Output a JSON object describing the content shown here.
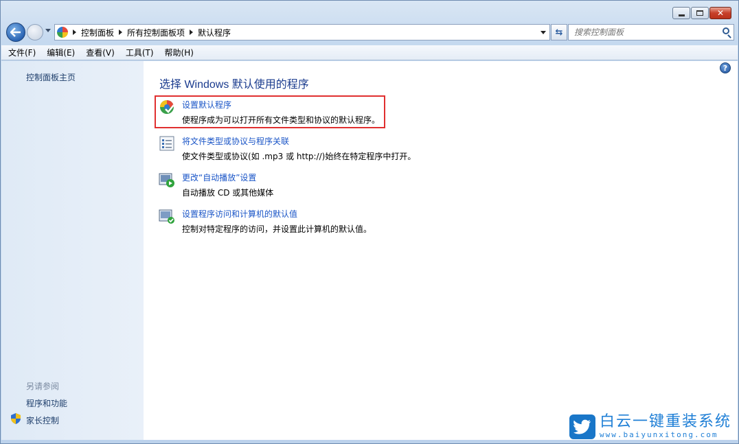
{
  "window": {
    "caption_buttons": {
      "minimize_icon": "minimize-icon",
      "maximize_icon": "maximize-icon",
      "close_label": "✕"
    }
  },
  "address_bar": {
    "breadcrumbs": [
      "控制面板",
      "所有控制面板项",
      "默认程序"
    ]
  },
  "search": {
    "placeholder": "搜索控制面板"
  },
  "menubar": {
    "items": [
      "文件(F)",
      "编辑(E)",
      "查看(V)",
      "工具(T)",
      "帮助(H)"
    ]
  },
  "sidebar": {
    "home_link": "控制面板主页",
    "see_also": "另请参阅",
    "links": [
      "程序和功能",
      "家长控制"
    ]
  },
  "main": {
    "heading": "选择 Windows 默认使用的程序",
    "tasks": [
      {
        "title": "设置默认程序",
        "desc": "使程序成为可以打开所有文件类型和协议的默认程序。",
        "icon": "default-programs-icon"
      },
      {
        "title": "将文件类型或协议与程序关联",
        "desc": "使文件类型或协议(如 .mp3 或 http://)始终在特定程序中打开。",
        "icon": "file-association-icon"
      },
      {
        "title": "更改“自动播放”设置",
        "desc": "自动播放 CD 或其他媒体",
        "icon": "autoplay-icon"
      },
      {
        "title": "设置程序访问和计算机的默认值",
        "desc": "控制对特定程序的访问，并设置此计算机的默认值。",
        "icon": "program-access-icon"
      }
    ]
  },
  "watermark": {
    "brand": "白云一键重装系统",
    "url": "www.baiyunxitong.com"
  },
  "colors": {
    "link": "#1a55c7",
    "heading": "#1a3b8e",
    "highlight": "#e02f2f"
  }
}
